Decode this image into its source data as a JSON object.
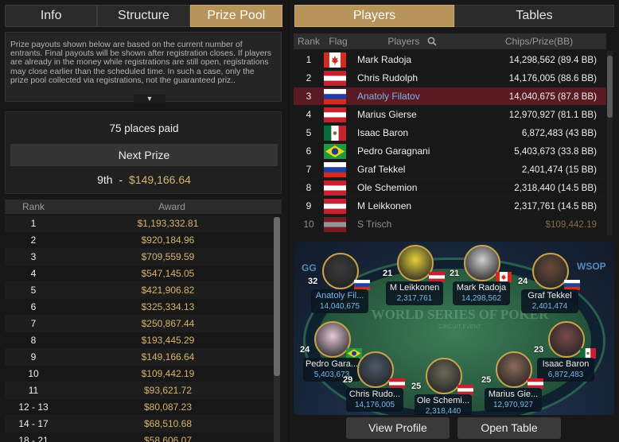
{
  "left_tabs": [
    "Info",
    "Structure",
    "Prize Pool"
  ],
  "notice": "Prize payouts shown below are based on the current number of entrants. Final payouts will be shown after registration closes. If players are already in the money while registrations are still open, registrations may close earlier than the scheduled time. In such a case, only the prize pool collected via registrations, not the guaranteed priz..",
  "places_paid": "75 places paid",
  "next_prize": {
    "label": "Next Prize",
    "rank": "9th",
    "sep": "-",
    "amount": "$149,166.64"
  },
  "award_header": {
    "rank": "Rank",
    "award": "Award"
  },
  "awards": [
    {
      "rank": "1",
      "award": "$1,193,332.81"
    },
    {
      "rank": "2",
      "award": "$920,184.96"
    },
    {
      "rank": "3",
      "award": "$709,559.59"
    },
    {
      "rank": "4",
      "award": "$547,145.05"
    },
    {
      "rank": "5",
      "award": "$421,906.82"
    },
    {
      "rank": "6",
      "award": "$325,334.13"
    },
    {
      "rank": "7",
      "award": "$250,867.44"
    },
    {
      "rank": "8",
      "award": "$193,445.29"
    },
    {
      "rank": "9",
      "award": "$149,166.64"
    },
    {
      "rank": "10",
      "award": "$109,442.19"
    },
    {
      "rank": "11",
      "award": "$93,621.72"
    },
    {
      "rank": "12 - 13",
      "award": "$80,087.23"
    },
    {
      "rank": "14 - 17",
      "award": "$68,510.68"
    },
    {
      "rank": "18 - 21",
      "award": "$58,606.07"
    }
  ],
  "right_tabs": [
    "Players",
    "Tables"
  ],
  "player_header": {
    "rank": "Rank",
    "flag": "Flag",
    "players": "Players",
    "chips": "Chips/Prize(BB)"
  },
  "players": [
    {
      "rank": "1",
      "name": "Mark Radoja",
      "chips": "14,298,562 (89.4 BB)",
      "flag": "ca"
    },
    {
      "rank": "2",
      "name": "Chris Rudolph",
      "chips": "14,176,005 (88.6 BB)",
      "flag": "at"
    },
    {
      "rank": "3",
      "name": "Anatoly Filatov",
      "chips": "14,040,675 (87.8 BB)",
      "flag": "ru"
    },
    {
      "rank": "4",
      "name": "Marius Gierse",
      "chips": "12,970,927 (81.1 BB)",
      "flag": "at"
    },
    {
      "rank": "5",
      "name": "Isaac Baron",
      "chips": "6,872,483 (43 BB)",
      "flag": "mx"
    },
    {
      "rank": "6",
      "name": "Pedro Garagnani",
      "chips": "5,403,673 (33.8 BB)",
      "flag": "br"
    },
    {
      "rank": "7",
      "name": "Graf Tekkel",
      "chips": "2,401,474 (15 BB)",
      "flag": "ru"
    },
    {
      "rank": "8",
      "name": "Ole Schemion",
      "chips": "2,318,440 (14.5 BB)",
      "flag": "at"
    },
    {
      "rank": "9",
      "name": "M Leikkonen",
      "chips": "2,317,761 (14.5 BB)",
      "flag": "at"
    },
    {
      "rank": "10",
      "name": "S Trisch",
      "chips": "$109,442.19",
      "flag": "at"
    }
  ],
  "table": {
    "logo": "WORLD SERIES OF POKER",
    "logo_sub": "CIRCUIT EVENT",
    "corner_left": "GG",
    "corner_right": "WSOP",
    "seats": [
      {
        "num": "32",
        "name": "Anatoly Fil...",
        "chips": "14,040,675",
        "flag": "ru"
      },
      {
        "num": "21",
        "name": "M Leikkonen",
        "chips": "2,317,761",
        "flag": "at"
      },
      {
        "num": "21",
        "name": "Mark Radoja",
        "chips": "14,298,562",
        "flag": "ca"
      },
      {
        "num": "24",
        "name": "Graf Tekkel",
        "chips": "2,401,474",
        "flag": "ru"
      },
      {
        "num": "24",
        "name": "Pedro Gara...",
        "chips": "5,403,673",
        "flag": "br"
      },
      {
        "num": "23",
        "name": "Isaac Baron",
        "chips": "6,872,483",
        "flag": "mx"
      },
      {
        "num": "29",
        "name": "Chris Rudo...",
        "chips": "14,176,005",
        "flag": "at"
      },
      {
        "num": "25",
        "name": "Ole Schemi...",
        "chips": "2,318,440",
        "flag": "at"
      },
      {
        "num": "25",
        "name": "Marius Gie...",
        "chips": "12,970,927",
        "flag": "at"
      }
    ]
  },
  "buttons": {
    "view_profile": "View Profile",
    "open_table": "Open Table"
  },
  "colors": {
    "accent_gold": "#b7955a",
    "prize_gold": "#d7b46a",
    "selected_row": "#5a1a22",
    "link_blue": "#7ab6ea"
  }
}
